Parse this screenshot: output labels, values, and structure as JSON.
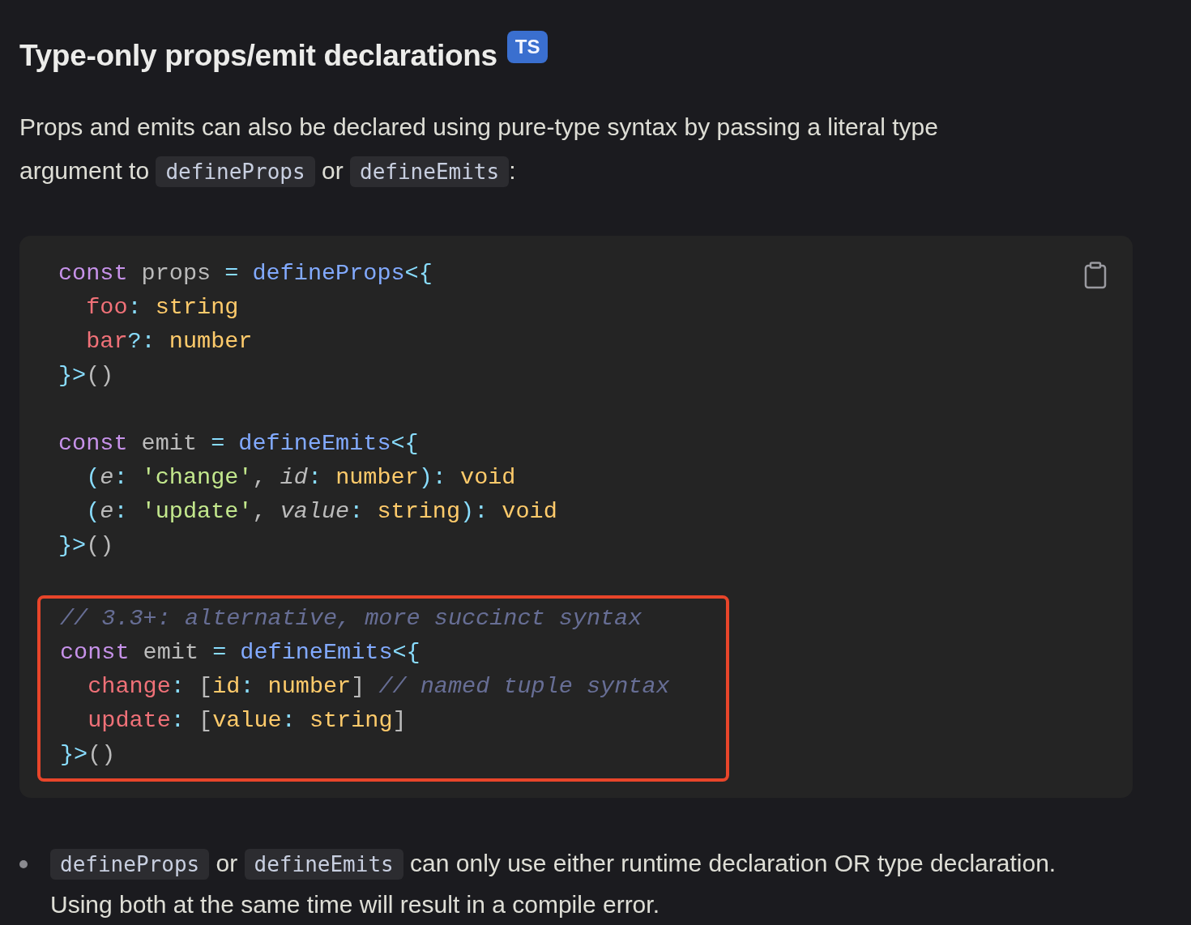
{
  "heading": {
    "title": "Type-only props/emit declarations",
    "badge": "TS"
  },
  "paragraph": [
    {
      "kind": "text",
      "text": "Props and emits can also be declared using pure-type syntax by passing a literal type argument to "
    },
    {
      "kind": "code",
      "text": "defineProps"
    },
    {
      "kind": "text",
      "text": " or "
    },
    {
      "kind": "code",
      "text": "defineEmits"
    },
    {
      "kind": "text",
      "text": ":"
    }
  ],
  "code_block": {
    "groups": [
      {
        "highlighted": false,
        "lines": [
          {
            "indented": false,
            "tokens": [
              {
                "kind": "keyword",
                "text": "const"
              },
              {
                "kind": "plain",
                "text": " props "
              },
              {
                "kind": "punct",
                "text": "= "
              },
              {
                "kind": "func",
                "text": "defineProps"
              },
              {
                "kind": "punct",
                "text": "<{"
              }
            ]
          },
          {
            "indented": true,
            "tokens": [
              {
                "kind": "prop",
                "text": "foo"
              },
              {
                "kind": "punct",
                "text": ": "
              },
              {
                "kind": "type",
                "text": "string"
              }
            ]
          },
          {
            "indented": true,
            "tokens": [
              {
                "kind": "prop",
                "text": "bar"
              },
              {
                "kind": "punct",
                "text": "?: "
              },
              {
                "kind": "type",
                "text": "number"
              }
            ]
          },
          {
            "indented": false,
            "tokens": [
              {
                "kind": "punct",
                "text": "}>"
              },
              {
                "kind": "plain",
                "text": "()"
              }
            ]
          }
        ]
      },
      {
        "highlighted": false,
        "lines": [
          {
            "indented": false,
            "tokens": [
              {
                "kind": "keyword",
                "text": "const"
              },
              {
                "kind": "plain",
                "text": " emit "
              },
              {
                "kind": "punct",
                "text": "= "
              },
              {
                "kind": "func",
                "text": "defineEmits"
              },
              {
                "kind": "punct",
                "text": "<{"
              }
            ]
          },
          {
            "indented": true,
            "tokens": [
              {
                "kind": "punct",
                "text": "("
              },
              {
                "kind": "param",
                "text": "e"
              },
              {
                "kind": "punct",
                "text": ": "
              },
              {
                "kind": "string",
                "text": "'change'"
              },
              {
                "kind": "plain",
                "text": ", "
              },
              {
                "kind": "param",
                "text": "id"
              },
              {
                "kind": "punct",
                "text": ": "
              },
              {
                "kind": "type",
                "text": "number"
              },
              {
                "kind": "punct",
                "text": "): "
              },
              {
                "kind": "type",
                "text": "void"
              }
            ]
          },
          {
            "indented": true,
            "tokens": [
              {
                "kind": "punct",
                "text": "("
              },
              {
                "kind": "param",
                "text": "e"
              },
              {
                "kind": "punct",
                "text": ": "
              },
              {
                "kind": "string",
                "text": "'update'"
              },
              {
                "kind": "plain",
                "text": ", "
              },
              {
                "kind": "param",
                "text": "value"
              },
              {
                "kind": "punct",
                "text": ": "
              },
              {
                "kind": "type",
                "text": "string"
              },
              {
                "kind": "punct",
                "text": "): "
              },
              {
                "kind": "type",
                "text": "void"
              }
            ]
          },
          {
            "indented": false,
            "tokens": [
              {
                "kind": "punct",
                "text": "}>"
              },
              {
                "kind": "plain",
                "text": "()"
              }
            ]
          }
        ]
      },
      {
        "highlighted": true,
        "lines": [
          {
            "indented": false,
            "tokens": [
              {
                "kind": "comment",
                "text": "// 3.3+: alternative, more succinct syntax"
              }
            ]
          },
          {
            "indented": false,
            "tokens": [
              {
                "kind": "keyword",
                "text": "const"
              },
              {
                "kind": "plain",
                "text": " emit "
              },
              {
                "kind": "punct",
                "text": "= "
              },
              {
                "kind": "func",
                "text": "defineEmits"
              },
              {
                "kind": "punct",
                "text": "<{"
              }
            ]
          },
          {
            "indented": true,
            "tokens": [
              {
                "kind": "prop",
                "text": "change"
              },
              {
                "kind": "punct",
                "text": ": "
              },
              {
                "kind": "plain",
                "text": "["
              },
              {
                "kind": "type",
                "text": "id"
              },
              {
                "kind": "punct",
                "text": ": "
              },
              {
                "kind": "type",
                "text": "number"
              },
              {
                "kind": "plain",
                "text": "] "
              },
              {
                "kind": "comment",
                "text": "// named tuple syntax"
              }
            ]
          },
          {
            "indented": true,
            "tokens": [
              {
                "kind": "prop",
                "text": "update"
              },
              {
                "kind": "punct",
                "text": ": "
              },
              {
                "kind": "plain",
                "text": "["
              },
              {
                "kind": "type",
                "text": "value"
              },
              {
                "kind": "punct",
                "text": ": "
              },
              {
                "kind": "type",
                "text": "string"
              },
              {
                "kind": "plain",
                "text": "]"
              }
            ]
          },
          {
            "indented": false,
            "tokens": [
              {
                "kind": "punct",
                "text": "}>"
              },
              {
                "kind": "plain",
                "text": "()"
              }
            ]
          }
        ]
      }
    ]
  },
  "bullets": [
    [
      {
        "kind": "code",
        "text": "defineProps"
      },
      {
        "kind": "text",
        "text": " or "
      },
      {
        "kind": "code",
        "text": "defineEmits"
      },
      {
        "kind": "text",
        "text": " can only use either runtime declaration OR type declaration. Using both at the same time will result in a compile error."
      }
    ]
  ]
}
